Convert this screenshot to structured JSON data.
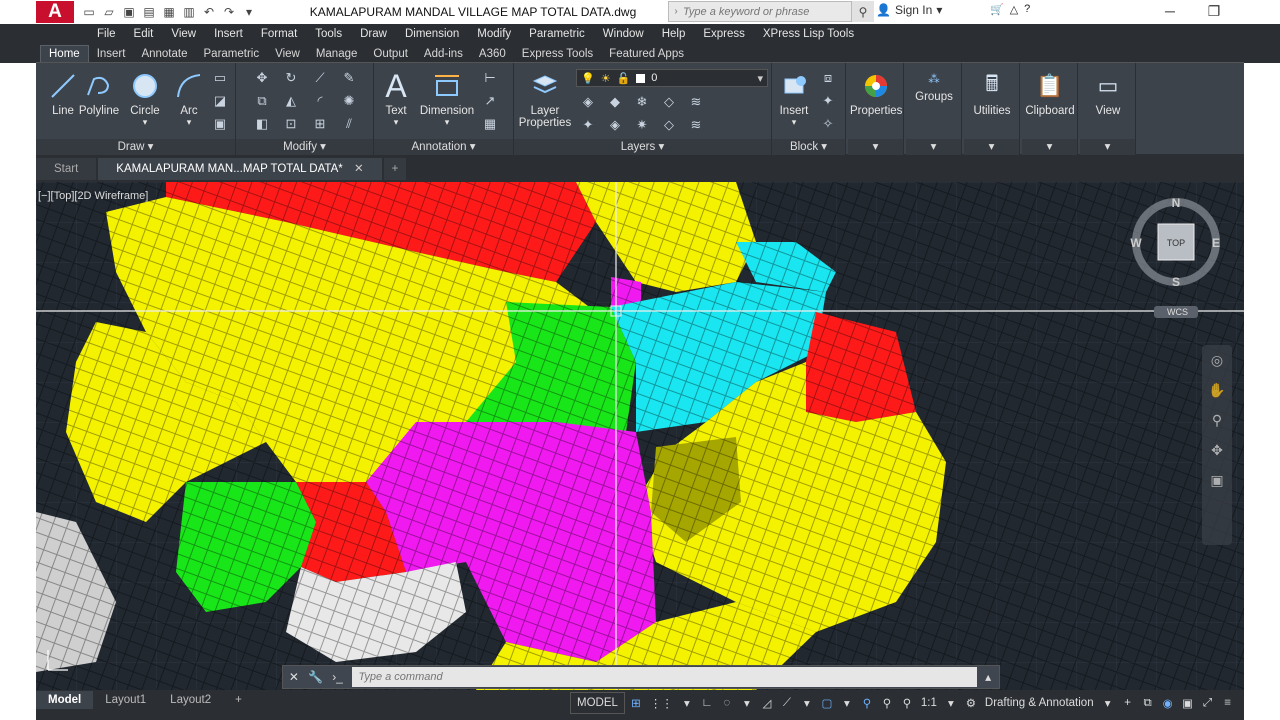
{
  "titlebar": {
    "doc_title": "KAMALAPURAM MANDAL VILLAGE MAP TOTAL DATA.dwg",
    "search_placeholder": "Type a keyword or phrase",
    "sign_in": "Sign In"
  },
  "menubar": {
    "items": [
      "File",
      "Edit",
      "View",
      "Insert",
      "Format",
      "Tools",
      "Draw",
      "Dimension",
      "Modify",
      "Parametric",
      "Window",
      "Help",
      "Express",
      "XPress Lisp Tools"
    ]
  },
  "ribbon_tabs": [
    "Home",
    "Insert",
    "Annotate",
    "Parametric",
    "View",
    "Manage",
    "Output",
    "Add-ins",
    "A360",
    "Express Tools",
    "Featured Apps"
  ],
  "ribbon": {
    "draw": {
      "title": "Draw",
      "line": "Line",
      "polyline": "Polyline",
      "circle": "Circle",
      "arc": "Arc"
    },
    "modify": {
      "title": "Modify"
    },
    "annotation": {
      "title": "Annotation",
      "text": "Text",
      "dimension": "Dimension"
    },
    "layers": {
      "title": "Layers",
      "layer_properties_1": "Layer",
      "layer_properties_2": "Properties",
      "current_layer": "0"
    },
    "block": {
      "title": "Block",
      "insert": "Insert"
    },
    "properties": "Properties",
    "groups": "Groups",
    "utilities": "Utilities",
    "clipboard": "Clipboard",
    "view": "View"
  },
  "doc_tabs": {
    "start": "Start",
    "active": "KAMALAPURAM MAN...MAP TOTAL DATA*",
    "plus": "+"
  },
  "viewport": {
    "label": "[−][Top][2D Wireframe]",
    "compass": {
      "n": "N",
      "s": "S",
      "e": "E",
      "w": "W",
      "cube": "TOP",
      "wcs": "WCS"
    }
  },
  "command": {
    "placeholder": "Type a command"
  },
  "layout_tabs": [
    "Model",
    "Layout1",
    "Layout2",
    "+"
  ],
  "status": {
    "model": "MODEL",
    "scale": "1:1",
    "workspace": "Drafting & Annotation"
  },
  "colors": {
    "red": "#ff1a1a",
    "yellow": "#f5f200",
    "green": "#19e619",
    "cyan": "#19e6f0",
    "magenta": "#f019f0",
    "white": "#e8e8e8",
    "olive": "#a6a600",
    "canvas": "#212830"
  }
}
